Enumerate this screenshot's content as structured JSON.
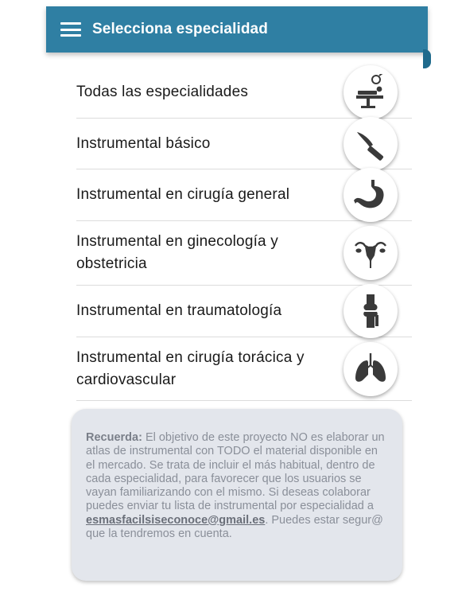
{
  "header": {
    "title": "Selecciona especialidad",
    "menu_icon": "hamburger-menu-icon"
  },
  "specialties": [
    {
      "label": "Todas las especialidades",
      "icon": "operating-table-icon"
    },
    {
      "label": "Instrumental básico",
      "icon": "scalpel-icon"
    },
    {
      "label": "Instrumental en cirugía general",
      "icon": "stomach-icon"
    },
    {
      "label": "Instrumental en ginecología y obstetricia",
      "icon": "uterus-icon"
    },
    {
      "label": "Instrumental en traumatología",
      "icon": "knee-joint-icon"
    },
    {
      "label": "Instrumental en cirugía torácica y cardiovascular",
      "icon": "lungs-icon"
    }
  ],
  "note": {
    "lead": "Recuerda:",
    "text1": " El objetivo de este proyecto NO es elaborar un atlas de instrumental con TODO el material disponible en el mercado. Se trata de incluir el más habitual, dentro de cada especialidad, para favorecer que los usuarios se vayan familiarizando con el mismo. Si deseas colaborar puedes enviar tu lista de instrumental por especialidad a ",
    "email": "esmasfacilsiseconoce@gmail.es",
    "text2": ". Puedes estar segur@ que la tendremos en cuenta."
  },
  "colors": {
    "header_bg": "#2f7fa3",
    "icon_fill": "#3a3a3a",
    "note_bg": "#e3e6ec"
  }
}
